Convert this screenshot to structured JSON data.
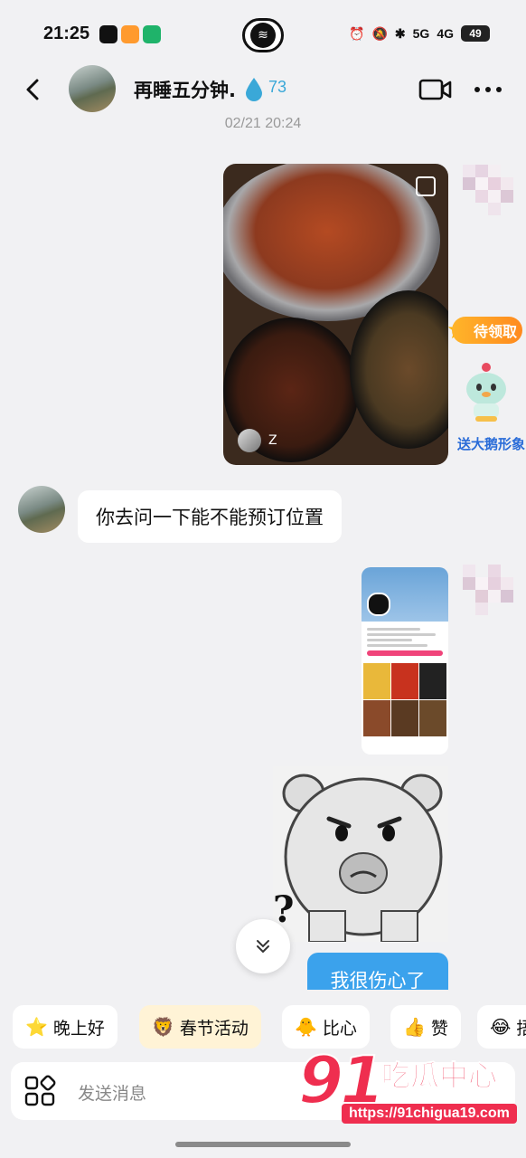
{
  "status_bar": {
    "time": "21:25",
    "network_1": "5G",
    "network_2": "4G",
    "battery": "49"
  },
  "header": {
    "title": "再睡五分钟.",
    "score": "73",
    "icons": [
      "back-icon",
      "avatar",
      "water-drop-icon",
      "video-call-icon",
      "more-icon"
    ]
  },
  "chat": {
    "timestamp": "02/21 20:24",
    "photo_user_label": "Z",
    "promo": {
      "badge": "待领取",
      "mascot_label": "送大鹅形象"
    },
    "left_message": "你去问一下能不能预订位置",
    "right_message": "我很伤心了",
    "meme_text": "?"
  },
  "quick_replies": [
    {
      "emoji": "⭐",
      "label": "晚上好"
    },
    {
      "emoji": "🦁",
      "label": "春节活动"
    },
    {
      "emoji": "🐥",
      "label": "比心"
    },
    {
      "emoji": "👍",
      "label": "赞"
    },
    {
      "emoji": "😂",
      "label": "捂"
    }
  ],
  "input": {
    "placeholder": "发送消息"
  },
  "watermark": {
    "number": "91",
    "text": "吃瓜中心",
    "url": "https://91chigua19.com"
  },
  "colors": {
    "accent_blue": "#3ba2ec",
    "score_blue": "#3aa8d8",
    "watermark_red": "#ef2e4f",
    "background": "#f1f1f3"
  }
}
